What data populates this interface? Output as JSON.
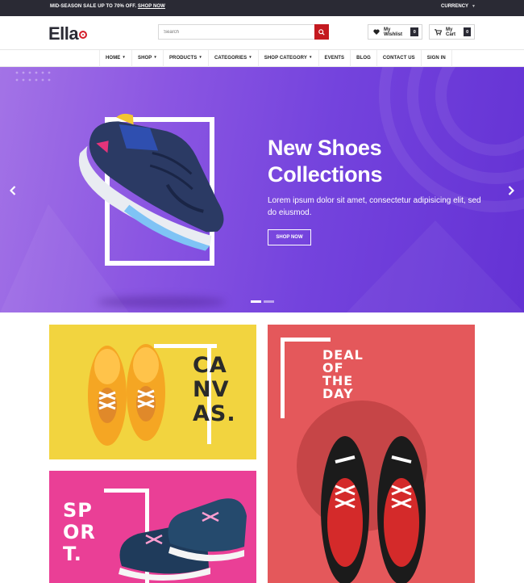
{
  "topbar": {
    "promo": "MID-SEASON SALE UP TO 70% OFF.",
    "promo_link": "SHOP NOW",
    "currency": "CURRENCY"
  },
  "header": {
    "logo": "Ella",
    "search_placeholder": "Search",
    "wishlist_label": "My Wishlist",
    "wishlist_count": "0",
    "cart_label": "My Cart",
    "cart_count": "0"
  },
  "nav": {
    "items": [
      {
        "label": "HOME",
        "dropdown": true
      },
      {
        "label": "SHOP",
        "dropdown": true
      },
      {
        "label": "PRODUCTS",
        "dropdown": true
      },
      {
        "label": "CATEGORIES",
        "dropdown": true
      },
      {
        "label": "SHOP CATEGORY",
        "dropdown": true
      },
      {
        "label": "EVENTS",
        "dropdown": false
      },
      {
        "label": "BLOG",
        "dropdown": false
      },
      {
        "label": "CONTACT US",
        "dropdown": false
      },
      {
        "label": "SIGN IN",
        "dropdown": false
      }
    ]
  },
  "hero": {
    "title_line1": "New Shoes",
    "title_line2": "Collections",
    "text": "Lorem ipsum dolor sit amet, consectetur adipisicing elit, sed do eiusmod.",
    "button": "SHOP NOW",
    "slide_index": 1,
    "slide_count": 2
  },
  "banners": {
    "canvas": {
      "line1": "CA",
      "line2": "NV",
      "line3": "AS."
    },
    "sport": {
      "line1": "SP",
      "line2": "OR",
      "line3": "T."
    },
    "deal": {
      "line1": "DEAL",
      "line2": "OF",
      "line3": "THE",
      "line4": "DAY"
    }
  },
  "colors": {
    "accent": "#c4191f",
    "dark": "#2a2a34",
    "hero_purple": "#7443dd",
    "canvas_yellow": "#f2d43f",
    "sport_pink": "#ea3f96",
    "deal_red": "#e4585b"
  },
  "icons": [
    "search-icon",
    "heart-icon",
    "cart-icon",
    "chevron-left-icon",
    "chevron-right-icon"
  ]
}
